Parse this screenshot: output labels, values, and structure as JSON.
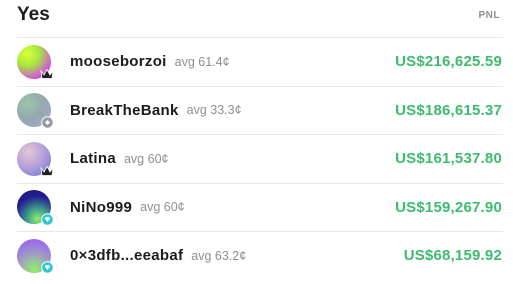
{
  "header": {
    "title": "Yes",
    "pnl_label": "PNL"
  },
  "traders": [
    {
      "name": "mooseborzoi",
      "avg": "avg 61.4¢",
      "pnl": "US$216,625.59",
      "badge": "crown-icon",
      "avatar_colors": [
        "#c7f23a",
        "#e043d6"
      ]
    },
    {
      "name": "BreakTheBank",
      "avg": "avg 33.3¢",
      "pnl": "US$186,615.37",
      "badge": "gray-badge-icon",
      "avatar_colors": [
        "#8fb8a0",
        "#a1a7c9"
      ]
    },
    {
      "name": "Latina",
      "avg": "avg 60¢",
      "pnl": "US$161,537.80",
      "badge": "crown-icon",
      "avatar_colors": [
        "#6a6fd9",
        "#d8b7cc"
      ]
    },
    {
      "name": "NiNo999",
      "avg": "avg 60¢",
      "pnl": "US$159,267.90",
      "badge": "diamond-icon",
      "avatar_colors": [
        "#1a1a8a",
        "#7be86b"
      ]
    },
    {
      "name": "0×3dfb...eeabaf",
      "avg": "avg 63.2¢",
      "pnl": "US$68,159.92",
      "badge": "diamond-icon",
      "avatar_colors": [
        "#9b6cf0",
        "#7ee07c"
      ]
    }
  ]
}
